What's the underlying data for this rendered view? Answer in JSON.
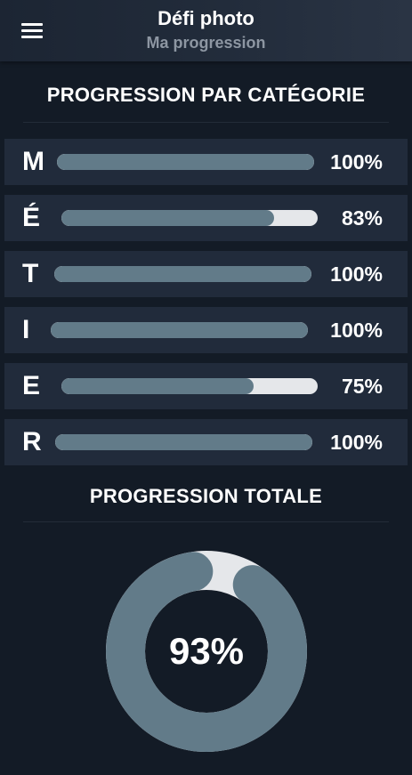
{
  "header": {
    "title": "Défi photo",
    "subtitle": "Ma progression",
    "menu_icon": "hamburger-menu-icon"
  },
  "categories_section": {
    "title": "PROGRESSION PAR CATÉGORIE",
    "items": [
      {
        "letter": "M",
        "percent_label": "100%",
        "progress": 1.0
      },
      {
        "letter": "É",
        "percent_label": "83%",
        "progress": 0.83
      },
      {
        "letter": "T",
        "percent_label": "100%",
        "progress": 1.0
      },
      {
        "letter": "I",
        "percent_label": "100%",
        "progress": 1.0
      },
      {
        "letter": "E",
        "percent_label": "75%",
        "progress": 0.75
      },
      {
        "letter": "R",
        "percent_label": "100%",
        "progress": 1.0
      }
    ]
  },
  "total_section": {
    "title": "PROGRESSION TOTALE",
    "percent_label": "93%",
    "progress": 0.93
  },
  "colors": {
    "background": "#131b26",
    "row_background": "#212b3b",
    "progress_fill": "#627b89",
    "progress_track": "#e5e7ea",
    "subtitle": "#8d96a2"
  }
}
